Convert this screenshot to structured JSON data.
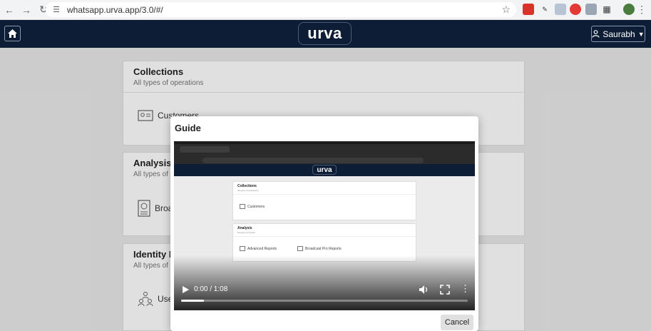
{
  "browser": {
    "url": "whatsapp.urva.app/3.0/#/"
  },
  "header": {
    "logo": "urva",
    "user_name": "Saurabh"
  },
  "cards": [
    {
      "title": "Collections",
      "subtitle": "All types of operations",
      "item": "Customers"
    },
    {
      "title": "Analysis",
      "subtitle": "All types of re",
      "item": "Broa"
    },
    {
      "title": "Identity M",
      "subtitle": "All types of us",
      "item": "Use"
    }
  ],
  "modal": {
    "title": "Guide",
    "cancel_label": "Cancel",
    "video": {
      "time": "0:00 / 1:08",
      "progress": 0.08,
      "logo": "urva",
      "preview_cards": [
        {
          "title": "Collections",
          "subtitle": "All types of operations",
          "items": [
            "Customers"
          ]
        },
        {
          "title": "Analysis",
          "subtitle": "All types of reports",
          "items": [
            "Advanced Reports",
            "Broadcast Pro Reports"
          ]
        }
      ]
    }
  },
  "colors": {
    "header_bg": "#0c1d35",
    "page_bg": "#e9e9e9"
  }
}
